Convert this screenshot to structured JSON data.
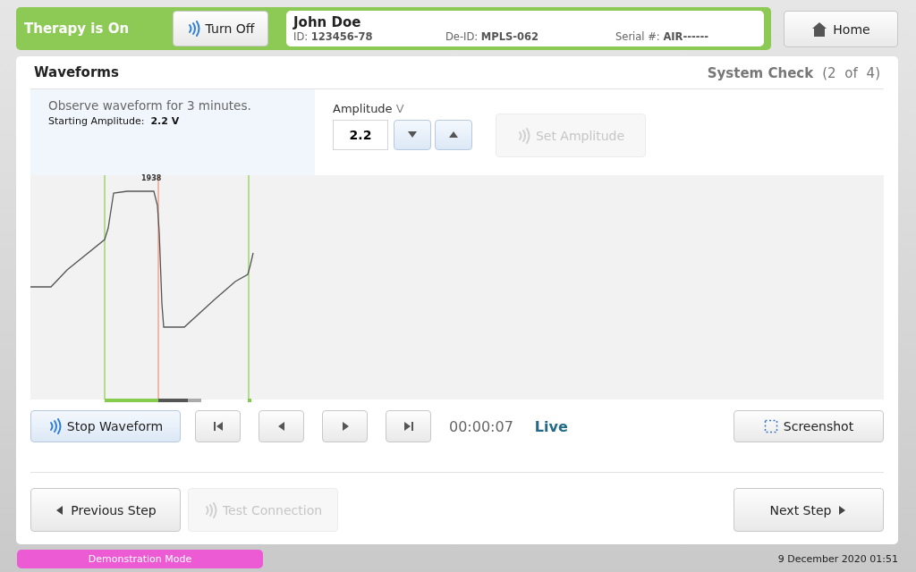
{
  "header": {
    "therapy_status": "Therapy is On",
    "therapy_on": true,
    "turn_off_button": "Turn Off",
    "patient": {
      "name": "John Doe",
      "id_label": "ID:",
      "id": "123456-78",
      "deid_label": "De-ID:",
      "deid": "MPLS-062",
      "serial_label": "Serial #:",
      "serial": "AIR------"
    },
    "home_button": "Home"
  },
  "panel": {
    "title": "Waveforms",
    "step_title": "System Check",
    "step_count": "(2 of 4)"
  },
  "instructions": {
    "text": "Observe waveform for 3 minutes.",
    "starting_label": "Starting Amplitude:",
    "starting_value": "2.2 V"
  },
  "amplitude": {
    "label": "Amplitude",
    "unit": "V",
    "value": "2.2",
    "set_button": {
      "label": "Set Amplitude",
      "disabled": true
    }
  },
  "waveform": {
    "marker_label": "1938"
  },
  "playback": {
    "stop_button": "Stop Waveform",
    "time": "00:00:07",
    "live": "Live",
    "screenshot_button": "Screenshot"
  },
  "footer_buttons": [
    {
      "kind": "previous",
      "label": "Previous Step",
      "disabled": false
    },
    {
      "kind": "test",
      "label": "Test Connection",
      "disabled": true
    },
    {
      "kind": "next",
      "label": "Next Step",
      "disabled": false
    }
  ],
  "status_bar": {
    "mode": "Demonstration Mode",
    "datetime": "9 December 2020 01:51"
  }
}
